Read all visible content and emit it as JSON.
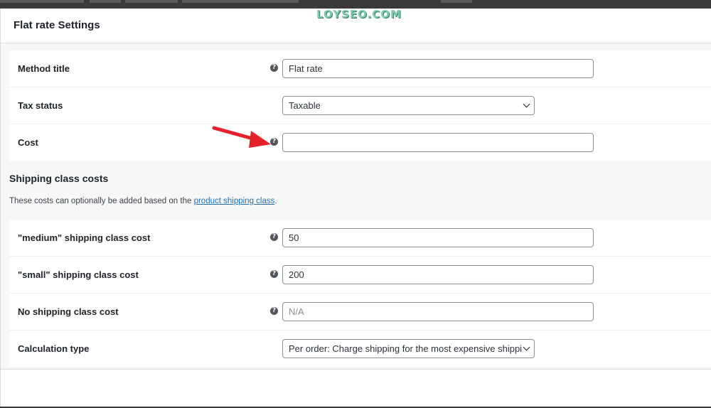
{
  "watermark": "LOYSEO.COM",
  "modal": {
    "title": "Flat rate Settings"
  },
  "fields": {
    "method_title": {
      "label": "Method title",
      "value": "Flat rate"
    },
    "tax_status": {
      "label": "Tax status",
      "value": "Taxable"
    },
    "cost": {
      "label": "Cost",
      "value": ""
    }
  },
  "shipping_classes": {
    "heading": "Shipping class costs",
    "description": "These costs can optionally be added based on the",
    "link_text": "product shipping class",
    "suffix": ".",
    "medium": {
      "label": "\"medium\" shipping class cost",
      "value": "50"
    },
    "small": {
      "label": "\"small\" shipping class cost",
      "value": "200"
    },
    "none": {
      "label": "No shipping class cost",
      "placeholder": "N/A"
    },
    "calculation": {
      "label": "Calculation type",
      "value": "Per order: Charge shipping for the most expensive shipping class"
    }
  },
  "icons": {
    "help": "help-tip-icon",
    "select": "chevron-down-icon",
    "annotation": "red-arrow"
  },
  "colors": {
    "link": "#2271b1",
    "arrow": "#e3222a",
    "help_icon": "#50575e"
  }
}
